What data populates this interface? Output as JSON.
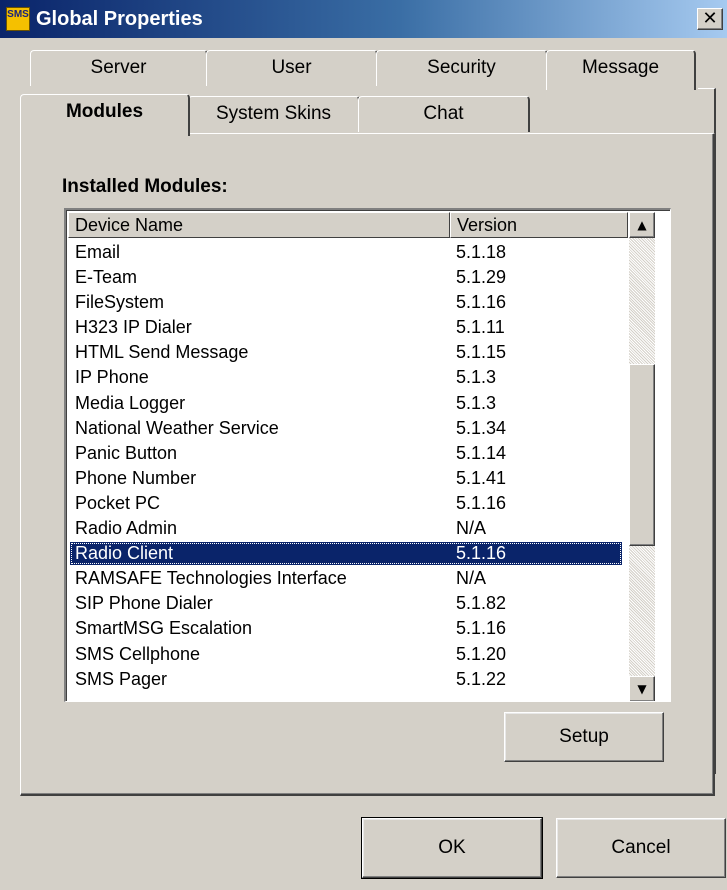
{
  "window": {
    "title": "Global Properties",
    "icon_text": "SMS",
    "close_glyph": "✕"
  },
  "tabs": {
    "row1": [
      "Server",
      "User",
      "Security",
      "Message"
    ],
    "row2": [
      "Modules",
      "System Skins",
      "Chat"
    ],
    "active": "Modules"
  },
  "section_label": "Installed Modules:",
  "list": {
    "headers": [
      "Device Name",
      "Version"
    ],
    "rows": [
      [
        "Email",
        "5.1.18"
      ],
      [
        "E-Team",
        "5.1.29"
      ],
      [
        "FileSystem",
        "5.1.16"
      ],
      [
        "H323 IP Dialer",
        "5.1.11"
      ],
      [
        "HTML Send Message",
        "5.1.15"
      ],
      [
        "IP Phone",
        "5.1.3"
      ],
      [
        "Media Logger",
        "5.1.3"
      ],
      [
        "National Weather Service",
        "5.1.34"
      ],
      [
        "Panic Button",
        "5.1.14"
      ],
      [
        "Phone Number",
        "5.1.41"
      ],
      [
        "Pocket PC",
        "5.1.16"
      ],
      [
        "Radio Admin",
        "N/A"
      ],
      [
        "Radio Client",
        "5.1.16"
      ],
      [
        "RAMSAFE Technologies Interface",
        "N/A"
      ],
      [
        "SIP Phone Dialer",
        "5.1.82"
      ],
      [
        "SmartMSG Escalation",
        "5.1.16"
      ],
      [
        "SMS Cellphone",
        "5.1.20"
      ],
      [
        "SMS Pager",
        "5.1.22"
      ]
    ],
    "selected_index": 12
  },
  "scrollbar": {
    "up_glyph": "▲",
    "down_glyph": "▼"
  },
  "buttons": {
    "setup": "Setup",
    "ok": "OK",
    "cancel": "Cancel"
  },
  "colors": {
    "title_bar": "#0a246a",
    "selection": "#0a246a",
    "face": "#d4d0c8"
  }
}
